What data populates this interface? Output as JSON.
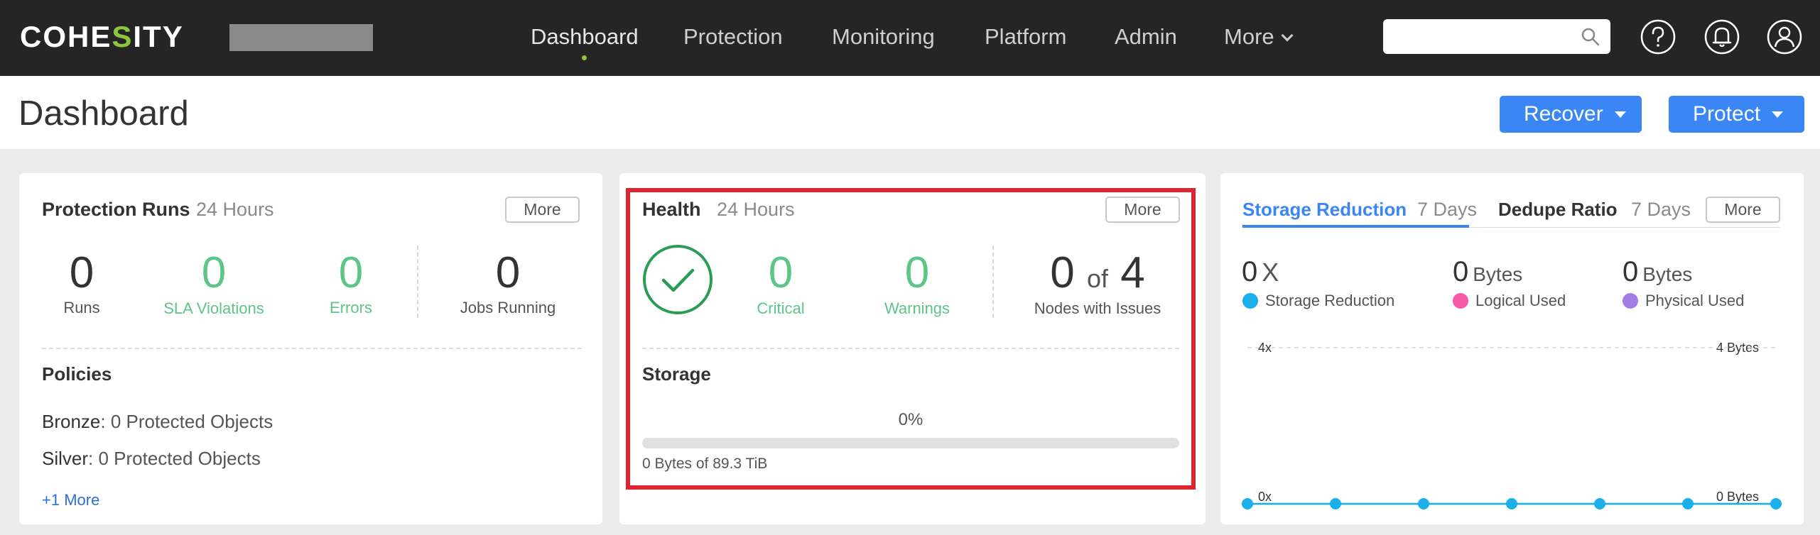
{
  "nav": {
    "logo_pre": "COHE",
    "logo_s": "S",
    "logo_post": "ITY",
    "links": [
      "Dashboard",
      "Protection",
      "Monitoring",
      "Platform",
      "Admin",
      "More"
    ],
    "active": "Dashboard",
    "search_placeholder": "",
    "icons": [
      "help-icon",
      "bell-icon",
      "user-icon"
    ]
  },
  "header": {
    "title": "Dashboard",
    "recover_label": "Recover",
    "protect_label": "Protect"
  },
  "protection_runs": {
    "title": "Protection Runs",
    "period": "24 Hours",
    "more_label": "More",
    "runs": {
      "value": "0",
      "label": "Runs"
    },
    "sla": {
      "value": "0",
      "label": "SLA Violations"
    },
    "errors": {
      "value": "0",
      "label": "Errors"
    },
    "jobs": {
      "value": "0",
      "label": "Jobs Running"
    },
    "policies_title": "Policies",
    "policies": [
      {
        "name": "Bronze",
        "sep": ":",
        "value": "0 Protected Objects"
      },
      {
        "name": "Silver",
        "sep": ":",
        "value": "0 Protected Objects"
      }
    ],
    "more_link": "+1 More"
  },
  "health": {
    "title": "Health",
    "period": "24 Hours",
    "more_label": "More",
    "critical": {
      "value": "0",
      "label": "Critical"
    },
    "warnings": {
      "value": "0",
      "label": "Warnings"
    },
    "nodes": {
      "value": "0",
      "of": "of",
      "total": "4",
      "label": "Nodes with Issues"
    },
    "storage_title": "Storage",
    "storage_percent": "0%",
    "storage_fraction": 0,
    "storage_text": "0 Bytes of 89.3 TiB"
  },
  "storage_reduction": {
    "tab_active": "Storage Reduction",
    "tab_active_period": "7 Days",
    "tab_other": "Dedupe Ratio",
    "tab_other_period": "7 Days",
    "more_label": "More",
    "stats": [
      {
        "value": "0",
        "unit": "X",
        "label": "Storage Reduction",
        "color": "#1ab0ea"
      },
      {
        "value": "0",
        "unit": "Bytes",
        "label": "Logical Used",
        "color": "#f65ba9"
      },
      {
        "value": "0",
        "unit": "Bytes",
        "label": "Physical Used",
        "color": "#a47de6"
      }
    ],
    "axis": {
      "left_top": "4x",
      "left_bottom": "0x",
      "right_top": "4 Bytes",
      "right_bottom": "0 Bytes"
    }
  },
  "chart_data": {
    "type": "line",
    "x": [
      1,
      2,
      3,
      4,
      5,
      6,
      7
    ],
    "series": [
      {
        "name": "Storage Reduction",
        "values": [
          0,
          0,
          0,
          0,
          0,
          0,
          0
        ],
        "color": "#1ab0ea"
      }
    ],
    "ylim": [
      0,
      4
    ],
    "y_ticks_left": [
      "0x",
      "4x"
    ],
    "y_ticks_right": [
      "0 Bytes",
      "4 Bytes"
    ]
  }
}
